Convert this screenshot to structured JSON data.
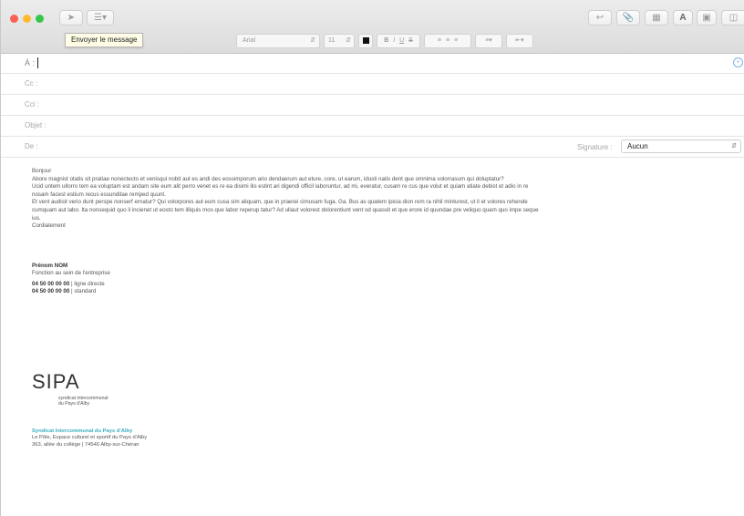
{
  "toolbar": {
    "send_tooltip": "Envoyer le message",
    "font_name": "Arial",
    "font_size": "11",
    "format_buttons": [
      "B",
      "I",
      "U",
      "S"
    ]
  },
  "fields": {
    "to_label": "À :",
    "cc_label": "Cc :",
    "bcc_label": "Cci :",
    "subject_label": "Objet :",
    "from_label": "De :",
    "signature_label": "Signature :",
    "signature_value": "Aucun"
  },
  "body": {
    "greeting": "Bonjour",
    "paragraph1": "Abore magnist otatis sit pratiae nonectecto et venisqui nobit aut es andi des eossimporum ario dendaerum aut eture, core, ut earum, idusti natis dent que omnima volorrasum qui doluptatur?",
    "paragraph2": "Ucid untem ullorro tem ea voluptam est andam site eum alit perro venet es re ea disimi ilis estint ari digendi officil laboruntur, ad mi, everatur, cusam re cus que volut et quiam atiate debist et adio in re nosam facest estium recus essunditae remped quunt.",
    "paragraph3": "Et vent audisit verio dunt perspe nonserf ernatur? Qui volorpores aut eum cusa sim aliquam, que in praerei cimusam fuga. Ga. Bus as quatem ipicia dion rem ra nihil minturest, ut il et volores rehende cumquam aut labo. Ita nonsequid quo il incienet ut eosto tem illiquis mos que labor reperup tatur? Ad ullaut volorest dolorentiunt vent od quassit et que erore id quundae pre veliquo quam quo impe seque ius.",
    "closing": "Cordialement"
  },
  "signature": {
    "name": "Prénom NOM",
    "role": "Fonction au sein de l'entreprise",
    "phone1": "04 50 00 00 00",
    "phone1_label": " | ligne directe",
    "phone2": "04 50 00 00 00",
    "phone2_label": " | standard"
  },
  "logo": {
    "text": "SIPA",
    "sub": "syndicat intercommunal du Pays d'Alby"
  },
  "org": {
    "name": "Syndicat Intercommunal du Pays d'Alby",
    "line1": "Le Pôle, Espace culturel et sportif du Pays d'Alby",
    "line2": "363, allée du collège | 74540 Alby-sur-Chéran"
  },
  "colors": {
    "accent": "#3aaec0",
    "close": "#fc5f57",
    "minimize": "#fdbc2e",
    "zoom": "#33c748"
  }
}
